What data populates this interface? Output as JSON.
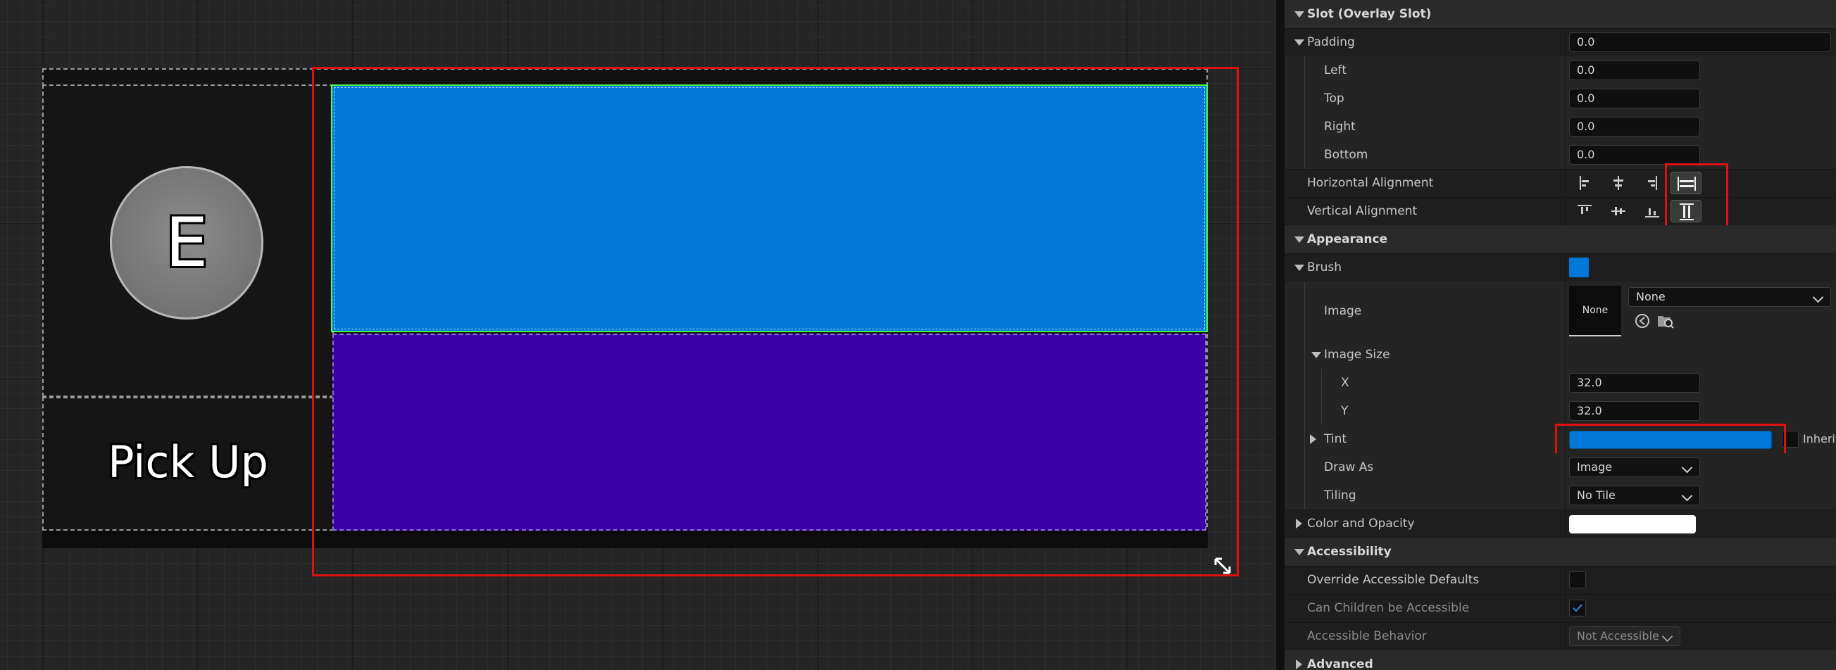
{
  "canvas": {
    "key_label": "E",
    "pick_up_label": "Pick Up",
    "colors": {
      "blue": "#0077d9",
      "purple": "#3c00a8",
      "selection": "#e01010",
      "green": "#4cff4c"
    }
  },
  "details": {
    "slot_header": "Slot (Overlay Slot)",
    "padding": {
      "label": "Padding",
      "value": "0.0",
      "left_label": "Left",
      "left_value": "0.0",
      "top_label": "Top",
      "top_value": "0.0",
      "right_label": "Right",
      "right_value": "0.0",
      "bottom_label": "Bottom",
      "bottom_value": "0.0"
    },
    "horizontal_alignment_label": "Horizontal Alignment",
    "vertical_alignment_label": "Vertical Alignment",
    "appearance_header": "Appearance",
    "brush": {
      "label": "Brush",
      "color": "#0077d9",
      "image_label": "Image",
      "image_thumb_text": "None",
      "image_combo_value": "None",
      "image_size_label": "Image Size",
      "x_label": "X",
      "x_value": "32.0",
      "y_label": "Y",
      "y_value": "32.0",
      "tint_label": "Tint",
      "tint_color": "#0077d9",
      "inherit_label": "Inherit",
      "draw_as_label": "Draw As",
      "draw_as_value": "Image",
      "tiling_label": "Tiling",
      "tiling_value": "No Tile"
    },
    "color_and_opacity_label": "Color and Opacity",
    "accessibility_header": "Accessibility",
    "override_accessible_defaults_label": "Override Accessible Defaults",
    "can_children_be_accessible_label": "Can Children be Accessible",
    "accessible_behavior_label": "Accessible Behavior",
    "accessible_behavior_value": "Not Accessible",
    "advanced_header": "Advanced"
  }
}
